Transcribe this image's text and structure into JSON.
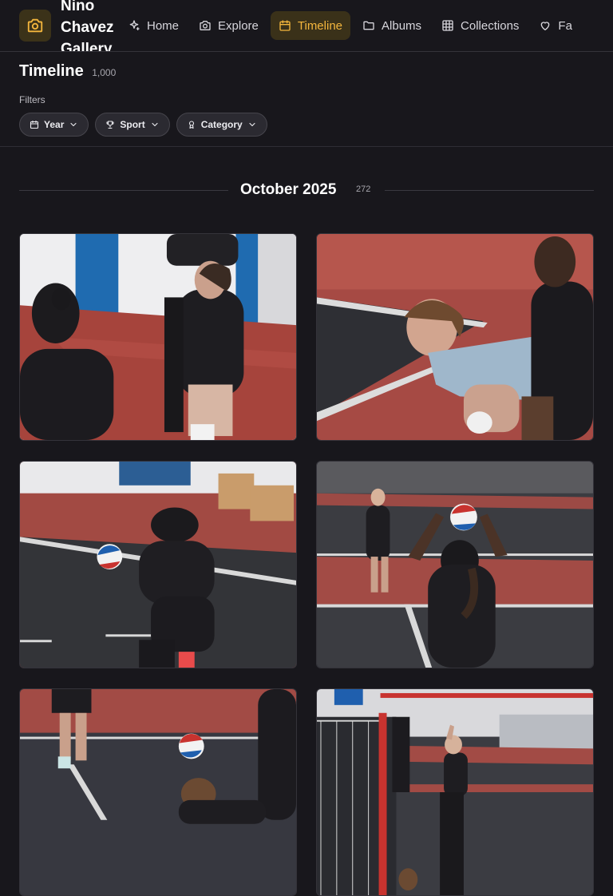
{
  "brand": {
    "name": "Nino Chavez Gallery",
    "icon": "camera-icon",
    "accent": "#f4b63d"
  },
  "nav": [
    {
      "label": "Home",
      "icon": "sparkles-icon",
      "active": false
    },
    {
      "label": "Explore",
      "icon": "camera-icon",
      "active": false
    },
    {
      "label": "Timeline",
      "icon": "calendar-icon",
      "active": true
    },
    {
      "label": "Albums",
      "icon": "folder-icon",
      "active": false
    },
    {
      "label": "Collections",
      "icon": "grid-icon",
      "active": false
    },
    {
      "label": "Fa",
      "icon": "heart-icon",
      "active": false
    }
  ],
  "page": {
    "title": "Timeline",
    "count": "1,000"
  },
  "filters": {
    "label": "Filters",
    "items": [
      {
        "label": "Year",
        "icon": "calendar-icon"
      },
      {
        "label": "Sport",
        "icon": "trophy-icon"
      },
      {
        "label": "Category",
        "icon": "award-icon"
      }
    ]
  },
  "section": {
    "title": "October 2025",
    "count": "272"
  },
  "photos": [
    {
      "alt": "Volleyball players on bench cheering"
    },
    {
      "alt": "Player crouched watching play"
    },
    {
      "alt": "Player passing volleyball"
    },
    {
      "alt": "Player setting volleyball"
    },
    {
      "alt": "Player diving for ball"
    },
    {
      "alt": "Player serving near net"
    }
  ]
}
